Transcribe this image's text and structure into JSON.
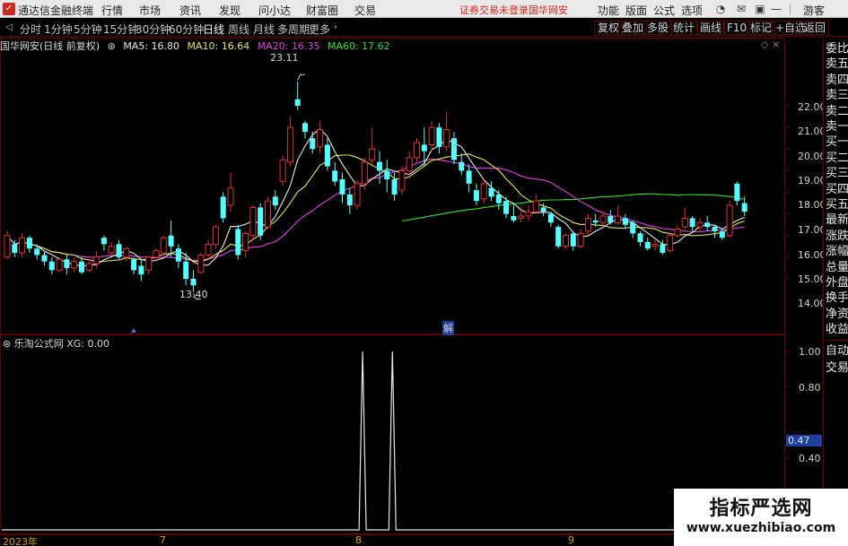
{
  "titlebar": {
    "app_title": "通达信金融终端",
    "menus": [
      "行情",
      "市场",
      "资讯",
      "发现",
      "问小达",
      "财富圈",
      "交易"
    ],
    "notice": "证券交易未登录",
    "stock_name": "国华网安",
    "right_menus": [
      "功能",
      "版面",
      "公式",
      "选项"
    ],
    "guest": "游客"
  },
  "toolbar": {
    "periods": [
      "分时",
      "1分钟",
      "5分钟",
      "15分钟",
      "30分钟",
      "60分钟",
      "日线",
      "周线",
      "月线",
      "多周期",
      "更多"
    ],
    "active_period": "日线",
    "right_buttons": [
      "复权",
      "叠加",
      "多股",
      "统计",
      "画线",
      "F10",
      "标记",
      "+自选",
      "返回"
    ]
  },
  "main_pane": {
    "title": "国华网安(日线 前复权)",
    "ma": [
      {
        "label": "MA5: 16.80",
        "color": "#e8e8e8"
      },
      {
        "label": "MA10: 16.64",
        "color": "#e6e65a"
      },
      {
        "label": "MA20: 16.35",
        "color": "#e040e0"
      },
      {
        "label": "MA60: 17.62",
        "color": "#2ee02e"
      }
    ],
    "high_label": "23.11",
    "low_label": "13.40",
    "marker_label": "解",
    "y_ticks": [
      "22.00",
      "21.00",
      "20.00",
      "19.00",
      "18.00",
      "17.00",
      "16.00",
      "15.00",
      "14.00"
    ]
  },
  "indicator_pane": {
    "title": "乐淘公式网 XG: 0.00",
    "y_ticks": [
      "1.00",
      "0.80",
      "0.47",
      "0.40"
    ],
    "current_value": "0.47"
  },
  "x_axis": [
    "2023年",
    "7",
    "8",
    "9"
  ],
  "sidebar": {
    "quote_items": [
      "委比",
      "卖五",
      "卖四",
      "卖三",
      "卖二",
      "卖一",
      "买一",
      "买二",
      "买三",
      "买四",
      "买五",
      "最新",
      "涨跌",
      "涨幅",
      "总量",
      "外盘",
      "换手",
      "净资",
      "收益"
    ],
    "trade_items": [
      "自动",
      "交易"
    ]
  },
  "watermark": {
    "title": "指标严选网",
    "url": "www.xuezhibiao.com"
  },
  "colors": {
    "up": "#e03030",
    "down": "#54ffff",
    "ma5": "#e8e8e8",
    "ma10": "#e6e65a",
    "ma20": "#e040e0",
    "ma60": "#2ee02e",
    "grid": "#5a0000"
  },
  "chart_data": [
    {
      "type": "candlestick",
      "title": "国华网安(日线 前复权)",
      "annotated_high": 23.11,
      "annotated_low": 13.4,
      "ma_last": {
        "MA5": 16.8,
        "MA10": 16.64,
        "MA20": 16.35,
        "MA60": 17.62
      },
      "candles": [
        [
          15.0,
          16.0,
          14.9,
          16.2
        ],
        [
          15.6,
          15.2,
          15.0,
          15.8
        ],
        [
          15.2,
          15.9,
          15.0,
          16.1
        ],
        [
          15.9,
          15.4,
          15.2,
          16.0
        ],
        [
          15.4,
          15.1,
          14.9,
          15.6
        ],
        [
          15.1,
          14.8,
          14.6,
          15.3
        ],
        [
          14.8,
          14.4,
          14.2,
          15.0
        ],
        [
          14.4,
          14.9,
          14.3,
          15.0
        ],
        [
          14.9,
          14.5,
          14.2,
          15.1
        ],
        [
          14.5,
          14.8,
          14.3,
          15.0
        ],
        [
          14.8,
          14.3,
          14.2,
          15.0
        ],
        [
          14.4,
          14.7,
          14.3,
          14.9
        ],
        [
          14.7,
          15.0,
          14.5,
          15.3
        ],
        [
          15.9,
          15.6,
          15.3,
          16.0
        ],
        [
          15.2,
          15.5,
          15.1,
          15.7
        ],
        [
          15.6,
          15.0,
          14.9,
          15.8
        ],
        [
          15.0,
          15.4,
          14.8,
          15.5
        ],
        [
          14.9,
          14.4,
          14.2,
          15.0
        ],
        [
          14.6,
          14.2,
          13.9,
          14.9
        ],
        [
          14.4,
          15.0,
          14.2,
          15.1
        ],
        [
          15.0,
          15.3,
          14.8,
          15.4
        ],
        [
          15.2,
          15.9,
          15.1,
          16.0
        ],
        [
          16.0,
          15.5,
          15.0,
          16.7
        ],
        [
          15.4,
          14.8,
          14.5,
          15.6
        ],
        [
          14.8,
          14.0,
          13.7,
          15.2
        ],
        [
          14.0,
          13.7,
          13.4,
          14.4
        ],
        [
          14.3,
          15.1,
          14.2,
          15.2
        ],
        [
          15.1,
          15.6,
          15.0,
          15.8
        ],
        [
          15.6,
          16.4,
          15.4,
          16.5
        ],
        [
          17.8,
          16.8,
          16.6,
          18.0
        ],
        [
          17.4,
          18.2,
          17.1,
          18.9
        ],
        [
          16.3,
          15.1,
          14.9,
          16.5
        ],
        [
          15.3,
          16.1,
          15.0,
          16.2
        ],
        [
          16.0,
          17.3,
          15.8,
          17.4
        ],
        [
          17.3,
          16.0,
          15.8,
          17.5
        ],
        [
          16.4,
          17.6,
          16.3,
          17.8
        ],
        [
          17.8,
          17.4,
          17.2,
          18.1
        ],
        [
          18.5,
          19.5,
          18.3,
          19.7
        ],
        [
          19.4,
          21.0,
          19.2,
          21.5
        ],
        [
          22.3,
          22.0,
          21.8,
          23.11
        ],
        [
          21.2,
          20.8,
          20.5,
          21.3
        ],
        [
          20.5,
          20.0,
          19.8,
          20.8
        ],
        [
          20.1,
          20.9,
          19.8,
          21.3
        ],
        [
          20.2,
          19.2,
          19.0,
          20.5
        ],
        [
          19.0,
          18.5,
          18.3,
          19.4
        ],
        [
          18.6,
          17.9,
          17.5,
          18.9
        ],
        [
          17.9,
          17.4,
          17.0,
          18.2
        ],
        [
          17.4,
          18.4,
          17.2,
          18.6
        ],
        [
          18.4,
          19.4,
          18.1,
          19.6
        ],
        [
          19.5,
          20.0,
          19.3,
          21.0
        ],
        [
          19.4,
          19.0,
          18.4,
          19.9
        ],
        [
          19.0,
          18.6,
          18.0,
          19.5
        ],
        [
          18.6,
          17.9,
          17.6,
          18.9
        ],
        [
          18.1,
          19.0,
          17.9,
          19.2
        ],
        [
          19.0,
          19.6,
          18.8,
          19.9
        ],
        [
          19.6,
          20.3,
          19.4,
          20.5
        ],
        [
          20.2,
          19.9,
          19.2,
          21.0
        ],
        [
          20.2,
          21.0,
          19.9,
          21.3
        ],
        [
          21.0,
          20.1,
          19.8,
          21.2
        ],
        [
          20.1,
          20.9,
          19.9,
          21.7
        ],
        [
          20.5,
          19.5,
          19.3,
          20.8
        ],
        [
          19.4,
          19.0,
          18.8,
          19.8
        ],
        [
          19.0,
          18.4,
          18.0,
          19.3
        ],
        [
          18.1,
          17.6,
          17.4,
          18.4
        ],
        [
          17.7,
          18.4,
          17.5,
          18.6
        ],
        [
          18.2,
          17.8,
          17.6,
          18.5
        ],
        [
          17.9,
          17.5,
          17.2,
          18.1
        ],
        [
          17.6,
          17.0,
          16.8,
          17.8
        ],
        [
          16.9,
          16.7,
          16.6,
          17.4
        ],
        [
          16.8,
          16.9,
          16.6,
          17.3
        ],
        [
          16.9,
          17.1,
          16.7,
          17.4
        ],
        [
          17.1,
          17.6,
          17.0,
          17.9
        ],
        [
          17.3,
          17.1,
          16.9,
          17.5
        ],
        [
          17.0,
          16.6,
          16.4,
          17.1
        ],
        [
          16.4,
          15.5,
          15.4,
          16.5
        ],
        [
          15.5,
          16.0,
          15.4,
          16.1
        ],
        [
          16.1,
          15.5,
          15.3,
          16.2
        ],
        [
          15.5,
          16.1,
          15.4,
          16.3
        ],
        [
          16.2,
          16.8,
          16.0,
          17.0
        ],
        [
          16.7,
          16.6,
          16.4,
          17.0
        ],
        [
          16.6,
          16.9,
          16.5,
          17.1
        ],
        [
          16.9,
          16.6,
          16.5,
          17.2
        ],
        [
          16.6,
          16.9,
          16.5,
          17.4
        ],
        [
          16.8,
          16.5,
          16.3,
          17.0
        ],
        [
          16.6,
          16.1,
          15.9,
          16.7
        ],
        [
          16.1,
          15.7,
          15.5,
          16.2
        ],
        [
          15.7,
          15.4,
          15.3,
          15.9
        ],
        [
          15.5,
          15.6,
          15.3,
          15.8
        ],
        [
          15.6,
          15.2,
          15.1,
          15.8
        ],
        [
          15.3,
          16.0,
          15.2,
          16.1
        ],
        [
          16.0,
          16.3,
          15.9,
          16.5
        ],
        [
          16.4,
          16.8,
          16.3,
          17.3
        ],
        [
          16.8,
          16.4,
          16.2,
          16.9
        ],
        [
          16.4,
          16.6,
          16.2,
          16.8
        ],
        [
          16.6,
          16.4,
          16.2,
          16.9
        ],
        [
          16.4,
          16.2,
          15.9,
          16.5
        ],
        [
          16.2,
          15.9,
          15.8,
          16.3
        ],
        [
          16.0,
          17.4,
          15.9,
          17.6
        ],
        [
          18.4,
          17.6,
          17.4,
          18.5
        ],
        [
          17.5,
          17.1,
          16.9,
          17.8
        ]
      ]
    },
    {
      "type": "line",
      "title": "乐淘公式网 XG: 0.00",
      "ylim": [
        0,
        1
      ],
      "series": [
        {
          "name": "XG",
          "pulses_at_index": [
            47,
            51
          ]
        }
      ]
    }
  ]
}
